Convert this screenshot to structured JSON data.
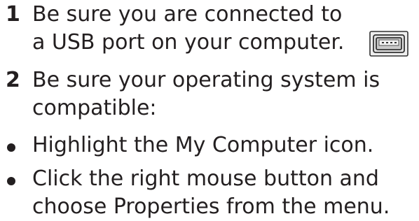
{
  "steps": [
    {
      "number": "1",
      "lines": [
        "Be sure you are connected to",
        "a USB port on your computer."
      ]
    },
    {
      "number": "2",
      "lines": [
        "Be sure your operating system is",
        "compatible:"
      ]
    }
  ],
  "bullets": [
    {
      "lines": [
        "Highlight the My Computer icon."
      ]
    },
    {
      "lines": [
        "Click the right mouse button and",
        "choose Properties from the menu."
      ]
    }
  ],
  "icons": {
    "usb_port": "usb-port-icon"
  }
}
